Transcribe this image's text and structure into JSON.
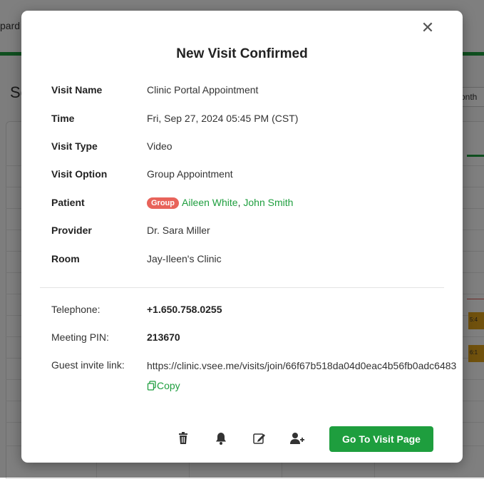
{
  "background": {
    "tab_fragment": "pard",
    "page_title_fragment": "Sc",
    "month_fragment": "onth",
    "events": [
      "5:4",
      "6:1"
    ]
  },
  "modal": {
    "close_glyph": "✕",
    "title": "New Visit Confirmed",
    "fields": {
      "visit_name": {
        "label": "Visit Name",
        "value": "Clinic Portal Appointment"
      },
      "time": {
        "label": "Time",
        "value": "Fri, Sep 27, 2024 05:45 PM (CST)"
      },
      "visit_type": {
        "label": "Visit Type",
        "value": "Video"
      },
      "visit_option": {
        "label": "Visit Option",
        "value": "Group Appointment"
      },
      "patient": {
        "label": "Patient",
        "badge": "Group",
        "names": [
          "Aileen White",
          "John Smith"
        ],
        "separator": ","
      },
      "provider": {
        "label": "Provider",
        "value": "Dr. Sara Miller"
      },
      "room": {
        "label": "Room",
        "value": "Jay-Ileen's Clinic"
      }
    },
    "dial_in": {
      "telephone": {
        "label": "Telephone:",
        "value": "+1.650.758.0255"
      },
      "meeting_pin": {
        "label": "Meeting PIN:",
        "value": "213670"
      },
      "guest_link": {
        "label": "Guest invite link:",
        "value": "https://clinic.vsee.me/visits/join/66f67b518da04d0eac4b56fb0adc6483",
        "copy_label": "Copy"
      }
    },
    "actions": {
      "icons": [
        "trash-icon",
        "bell-icon",
        "edit-icon",
        "add-user-icon"
      ],
      "go_button": "Go To Visit Page"
    }
  },
  "colors": {
    "accent": "#1e9e3e",
    "badge": "#e8635a"
  }
}
